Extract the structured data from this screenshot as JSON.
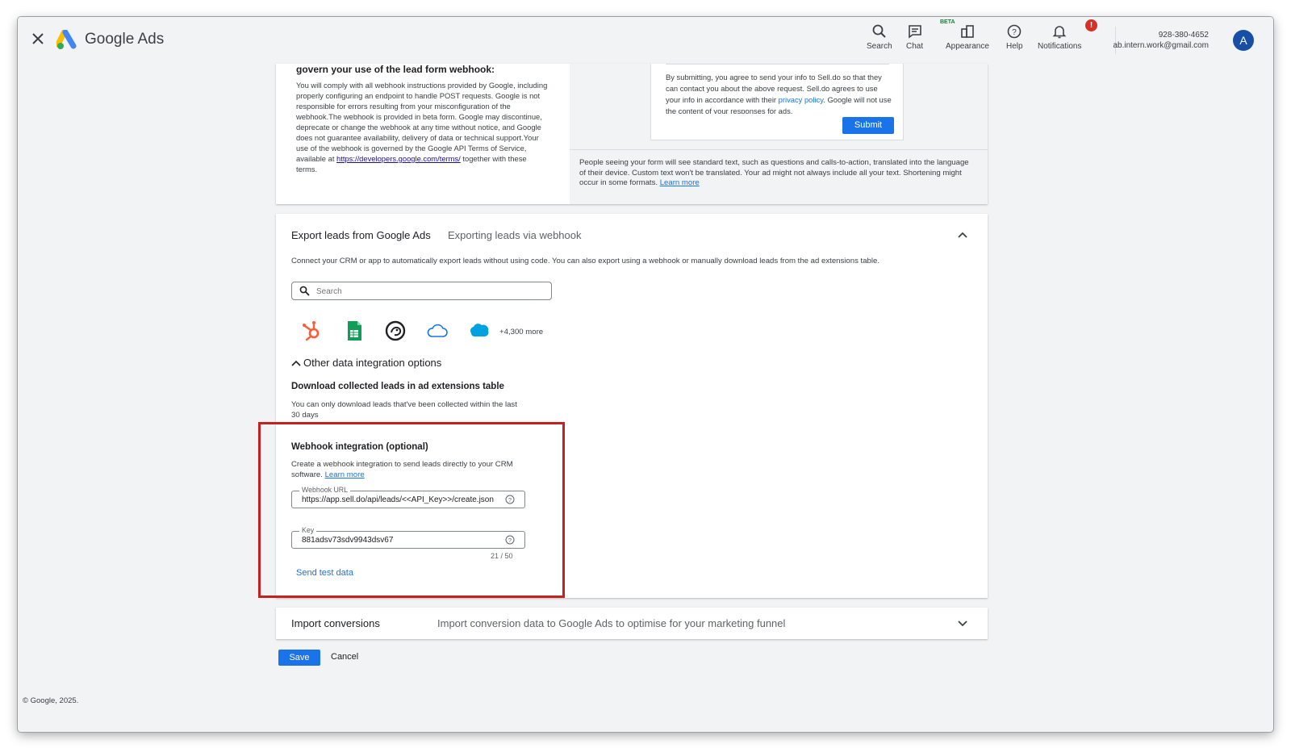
{
  "app": {
    "brand": "Google Ads"
  },
  "nav": {
    "search": "Search",
    "chat": "Chat",
    "beta": "BETA",
    "appearance": "Appearance",
    "help": "Help",
    "notifications": "Notifications",
    "notification_badge": "!"
  },
  "account": {
    "phone": "928-380-4652",
    "email": "ab.intern.work@gmail.com",
    "avatar_letter": "A"
  },
  "terms": {
    "heading": "govern your use of the lead form webhook:",
    "body": "You will comply with all webhook instructions provided by Google, including properly configuring an endpoint to handle POST requests. Google is not responsible for errors resulting from your misconfiguration of the webhook.The webhook is provided in beta form. Google may discontinue, deprecate or change the webhook at any time without notice, and Google does not guarantee availability, delivery of data or technical support.Your use of the webhook is governed by the Google API Terms of Service, available at ",
    "link": "https://developers.google.com/terms/",
    "tail": " together with these terms."
  },
  "preview": {
    "consent_text": "By submitting, you agree to send your info to Sell.do so that they can contact you about the above request. Sell.do agrees to use your info in accordance with their ",
    "privacy_link": "privacy policy",
    "consent_tail": ". Google will not use the content of your responses for ads.",
    "submit_label": "Submit",
    "note": "People seeing your form will see standard text, such as questions and calls-to-action, translated into the language of their device. Custom text won't be translated. Your ad might not always include all your text. Shortening might occur in some formats. ",
    "note_link": "Learn more"
  },
  "export": {
    "title": "Export leads from Google Ads",
    "subtitle": "Exporting leads via webhook",
    "description": "Connect your CRM or app to automatically export leads without using code. You can also export using a webhook or manually download leads from the ad extensions table.",
    "search_placeholder": "Search",
    "more_integrations": "+4,300 more",
    "other_options": "Other data integration options",
    "download_title": "Download collected leads in ad extensions table",
    "download_desc": "You can only download leads that've been collected within the last 30 days"
  },
  "webhook": {
    "title": "Webhook integration (optional)",
    "desc": "Create a webhook integration to send leads directly to your CRM software. ",
    "desc_link": "Learn more",
    "url_label": "Webhook URL",
    "url_value": "https://app.sell.do/api/leads/<<API_Key>>/create.json",
    "key_label": "Key",
    "key_value": "881adsv73sdv9943dsv67",
    "counter": "21 / 50",
    "send_test": "Send test data"
  },
  "import": {
    "title": "Import conversions",
    "subtitle": "Import conversion data to Google Ads to optimise for your marketing funnel"
  },
  "actions": {
    "save": "Save",
    "cancel": "Cancel"
  },
  "footer": "© Google, 2025."
}
